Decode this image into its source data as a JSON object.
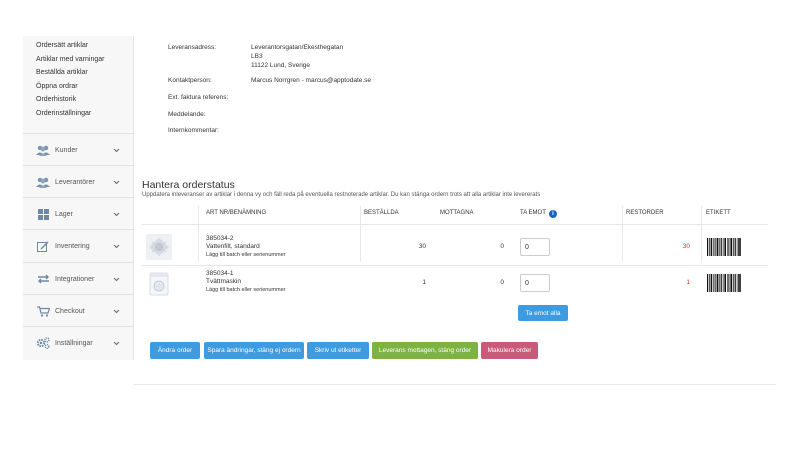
{
  "sidebar": {
    "links": [
      "Ordersätt artiklar",
      "Artiklar med varningar",
      "Beställda artiklar",
      "Öppna ordrar",
      "Orderhistorik",
      "Orderinställningar"
    ],
    "nav": [
      {
        "label": "Kunder",
        "icon": "users-icon"
      },
      {
        "label": "Leverantörer",
        "icon": "users-icon"
      },
      {
        "label": "Lager",
        "icon": "grid-icon"
      },
      {
        "label": "Inventering",
        "icon": "edit-icon"
      },
      {
        "label": "Integrationer",
        "icon": "arrows-icon"
      },
      {
        "label": "Checkout",
        "icon": "cart-icon"
      },
      {
        "label": "Inställningar",
        "icon": "cogs-icon"
      }
    ]
  },
  "order_info": {
    "delivery_label": "Leveransadress:",
    "delivery_lines": [
      "Leverantorsgatan/Ekesthegatan",
      "LB3",
      "11122 Lund, Sverige"
    ],
    "contact_label": "Kontaktperson:",
    "contact_value": "Marcus Norrgren - marcus@apptodate.se",
    "ext_ref_label": "Ext. faktura referens:",
    "message_label": "Meddelande:",
    "internal_comment_label": "Internkommentar:"
  },
  "manage": {
    "title": "Hantera orderstatus",
    "description": "Uppdatera inleveranser av artiklar i denna vy och fäll reda på eventuella restnoterade artiklar. Du kan stänga ordern trots att alla artiklar inte levererats"
  },
  "table": {
    "headers": {
      "art": "ART NR/BENÄMNING",
      "ordered": "BESTÄLLDA",
      "received": "MOTTAGNA",
      "receive": "TA EMOT",
      "backorder": "RESTORDER",
      "label": "ETIKETT"
    },
    "rows": [
      {
        "art_nr": "385034-2",
        "name": "Vattenfilt, standard",
        "meta": "Lägg till batch eller serienummer",
        "ordered": "30",
        "received": "0",
        "receive": "0",
        "backorder": "30"
      },
      {
        "art_nr": "385034-1",
        "name": "Tvättmaskin",
        "meta": "Lägg till batch eller serienummer",
        "ordered": "1",
        "received": "0",
        "receive": "0",
        "backorder": "1"
      }
    ],
    "receive_all": "Ta emot alla"
  },
  "actions": {
    "change_order": "Ändra order",
    "save_changes": "Spara ändringar, stäng ej ordern",
    "print_labels": "Skriv ut etiketter",
    "delivery_received": "Leverans mottagen, stäng order",
    "cancel_order": "Makulera order"
  },
  "colors": {
    "primary_blue": "#3e9be0",
    "success_green": "#7cb342",
    "danger_rose": "#c95b7a",
    "backorder_red": "#d0342c",
    "info_blue": "#1565c0"
  }
}
